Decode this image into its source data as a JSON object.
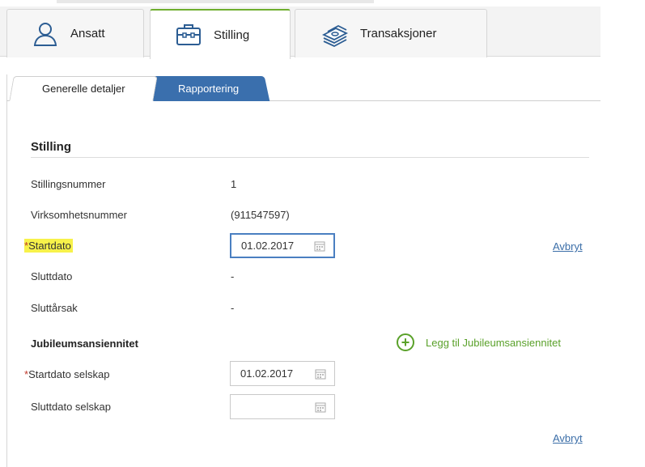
{
  "main_tabs": [
    {
      "label": "Ansatt",
      "icon": "person-icon"
    },
    {
      "label": "Stilling",
      "icon": "briefcase-icon"
    },
    {
      "label": "Transaksjoner",
      "icon": "money-stack-icon"
    }
  ],
  "sub_tabs": [
    {
      "label": "Generelle detaljer"
    },
    {
      "label": "Rapportering"
    }
  ],
  "section": {
    "title": "Stilling",
    "rows": {
      "stillingsnummer": {
        "label": "Stillingsnummer",
        "value": "1"
      },
      "virksomhetsnummer": {
        "label": "Virksomhetsnummer",
        "value": "(911547597)"
      },
      "startdato": {
        "required_marker": "*",
        "label": "Startdato",
        "value": "01.02.2017"
      },
      "sluttdato": {
        "label": "Sluttdato",
        "value": "-"
      },
      "sluttarsak": {
        "label": "Sluttårsak",
        "value": "-"
      }
    },
    "cancel_label": "Avbryt"
  },
  "jubileum": {
    "title": "Jubileumsansiennitet",
    "add_label": "Legg til Jubileumsansiennitet",
    "startdato_selskap": {
      "required_marker": "*",
      "label": "Startdato selskap",
      "value": "01.02.2017"
    },
    "sluttdato_selskap": {
      "label": "Sluttdato selskap",
      "value": ""
    },
    "cancel_label": "Avbryt"
  },
  "colors": {
    "active_tab_accent": "#6fae2e",
    "subtab_active_bg": "#3a6fad",
    "link": "#3b6ea8",
    "add_green": "#5aa12a",
    "required": "#c0392b",
    "highlight": "#f7f24a"
  }
}
